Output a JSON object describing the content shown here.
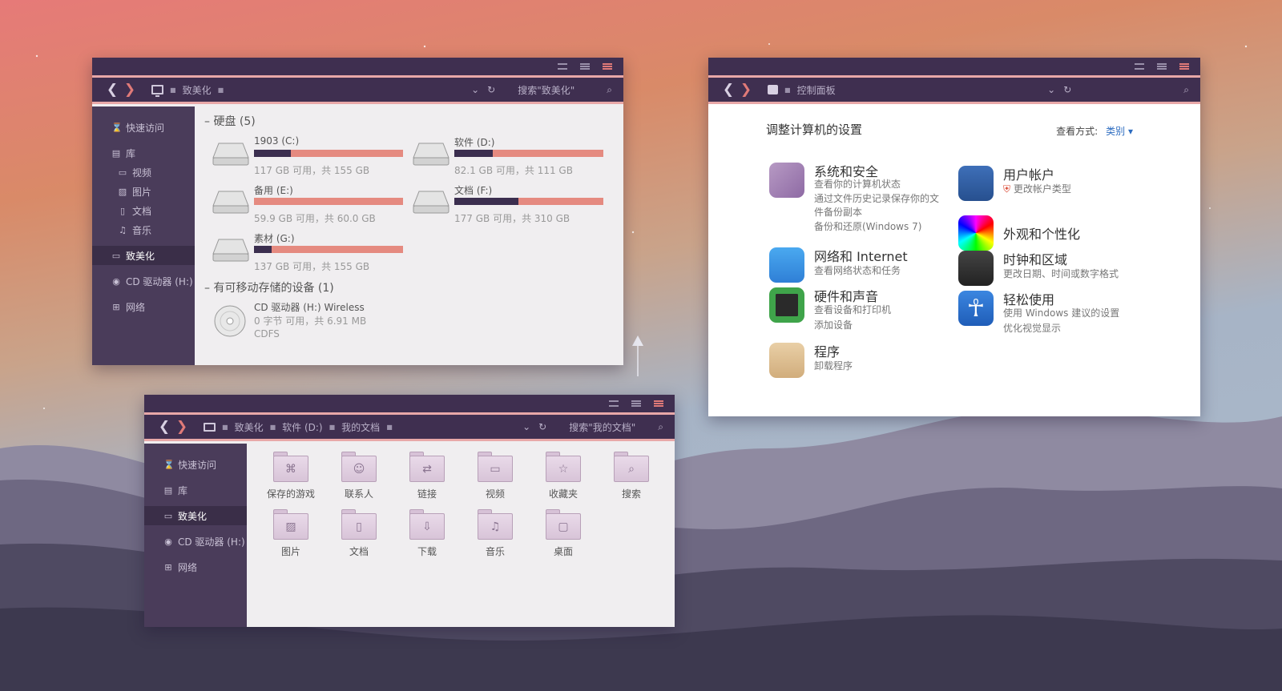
{
  "colors": {
    "accent": "#e07a78",
    "titlebar": "#3f2f50",
    "sidebar": "#4a3c5a",
    "bar_used": "#3b2e4f",
    "bar_free": "#e58a80"
  },
  "explorer1": {
    "breadcrumb": [
      "致美化"
    ],
    "search_placeholder": "搜索\"致美化\"",
    "sidebar": [
      {
        "label": "快速访问",
        "icon": "hourglass-icon"
      },
      {
        "label": "库",
        "icon": "library-icon"
      },
      {
        "label": "视频",
        "icon": "video-icon"
      },
      {
        "label": "图片",
        "icon": "picture-icon"
      },
      {
        "label": "文档",
        "icon": "document-icon"
      },
      {
        "label": "音乐",
        "icon": "music-icon"
      },
      {
        "label": "致美化",
        "icon": "computer-icon"
      },
      {
        "label": "CD 驱动器 (H:)",
        "icon": "cd-icon"
      },
      {
        "label": "网络",
        "icon": "network-icon"
      }
    ],
    "hdd_header": "硬盘 (5)",
    "drives": [
      {
        "name": "1903 (C:)",
        "free": "117 GB 可用，共 155 GB",
        "used_fraction": 0.245
      },
      {
        "name": "软件 (D:)",
        "free": "82.1 GB 可用，共 111 GB",
        "used_fraction": 0.26
      },
      {
        "name": "备用 (E:)",
        "free": "59.9 GB 可用，共 60.0 GB",
        "used_fraction": 0.0
      },
      {
        "name": "文档 (F:)",
        "free": "177 GB 可用，共 310 GB",
        "used_fraction": 0.43
      },
      {
        "name": "素材 (G:)",
        "free": "137 GB 可用，共 155 GB",
        "used_fraction": 0.12
      }
    ],
    "removable_header": "有可移动存储的设备 (1)",
    "cd": {
      "name": "CD 驱动器 (H:) Wireless",
      "free": "0 字节 可用，共 6.91 MB",
      "fs": "CDFS"
    }
  },
  "control_panel": {
    "breadcrumb": "控制面板",
    "title": "调整计算机的设置",
    "view_label": "查看方式:",
    "view_value": "类别",
    "items": [
      {
        "title": "系统和安全",
        "links": [
          "查看你的计算机状态",
          "通过文件历史记录保存你的文",
          "件备份副本",
          "备份和还原(Windows 7)"
        ]
      },
      {
        "title": "网络和 Internet",
        "links": [
          "查看网络状态和任务"
        ]
      },
      {
        "title": "硬件和声音",
        "links": [
          "查看设备和打印机",
          "添加设备"
        ]
      },
      {
        "title": "程序",
        "links": [
          "卸载程序"
        ]
      },
      {
        "title": "用户帐户",
        "links": [
          "更改帐户类型"
        ]
      },
      {
        "title": "外观和个性化",
        "links": []
      },
      {
        "title": "时钟和区域",
        "links": [
          "更改日期、时间或数字格式"
        ]
      },
      {
        "title": "轻松使用",
        "links": [
          "使用 Windows 建议的设置",
          "优化视觉显示"
        ]
      }
    ]
  },
  "explorer2": {
    "breadcrumb": [
      "致美化",
      "软件 (D:)",
      "我的文档"
    ],
    "search_placeholder": "搜索\"我的文档\"",
    "sidebar": [
      {
        "label": "快速访问",
        "icon": "hourglass-icon"
      },
      {
        "label": "库",
        "icon": "library-icon"
      },
      {
        "label": "致美化",
        "icon": "computer-icon"
      },
      {
        "label": "CD 驱动器 (H:)",
        "icon": "cd-icon"
      },
      {
        "label": "网络",
        "icon": "network-icon"
      }
    ],
    "folders": [
      {
        "label": "保存的游戏",
        "icon": "gamepad-icon",
        "glyph": "⌘"
      },
      {
        "label": "联系人",
        "icon": "contact-icon",
        "glyph": "☺"
      },
      {
        "label": "链接",
        "icon": "link-icon",
        "glyph": "⇄"
      },
      {
        "label": "视频",
        "icon": "video-icon",
        "glyph": "▭"
      },
      {
        "label": "收藏夹",
        "icon": "star-icon",
        "glyph": "☆"
      },
      {
        "label": "搜索",
        "icon": "search-icon",
        "glyph": "⌕"
      },
      {
        "label": "图片",
        "icon": "picture-icon",
        "glyph": "▨"
      },
      {
        "label": "文档",
        "icon": "document-icon",
        "glyph": "▯"
      },
      {
        "label": "下载",
        "icon": "download-icon",
        "glyph": "⇩"
      },
      {
        "label": "音乐",
        "icon": "music-icon",
        "glyph": "♫"
      },
      {
        "label": "桌面",
        "icon": "desktop-icon",
        "glyph": "▢"
      }
    ]
  }
}
